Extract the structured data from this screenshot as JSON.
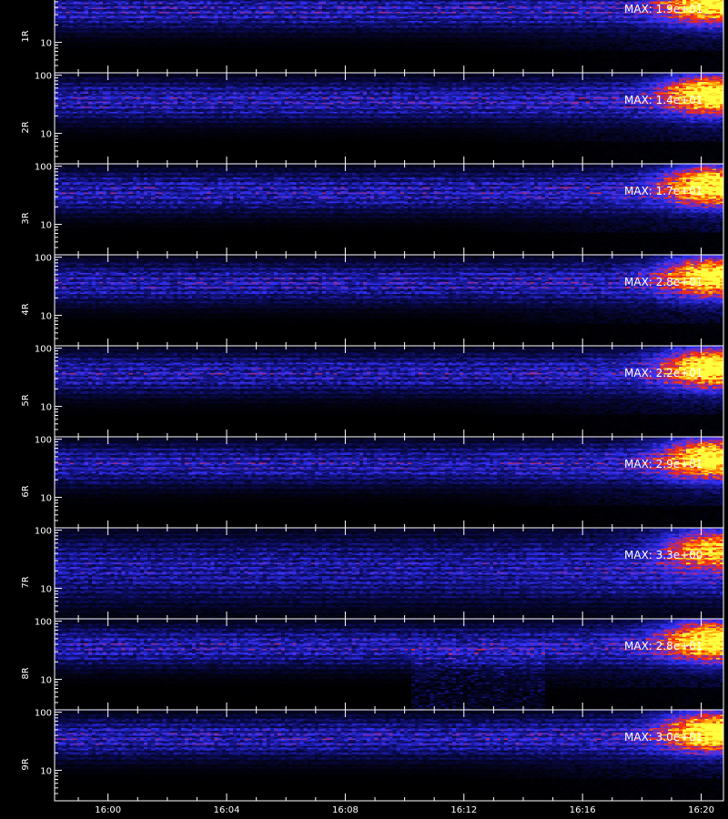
{
  "chart_data": {
    "type": "heatmap",
    "x_ticks": [
      "16:00",
      "16:04",
      "16:08",
      "16:12",
      "16:16",
      "16:20"
    ],
    "x_range": [
      "15:58:12",
      "16:20:45"
    ],
    "y_scale": "log",
    "y_ticks": [
      100,
      10
    ],
    "y_range": [
      3,
      110
    ],
    "colormap": [
      "#000000",
      "#0a0a50",
      "#1c1ca8",
      "#3232ff",
      "#a02a8a",
      "#ff2a00",
      "#ffa000",
      "#ffff40"
    ],
    "panels": [
      {
        "label": "1R",
        "max": "MAX: 1.9e+01"
      },
      {
        "label": "2R",
        "max": "MAX: 1.4e+01"
      },
      {
        "label": "3R",
        "max": "MAX: 1.7e+01"
      },
      {
        "label": "4R",
        "max": "MAX: 2.8e+01"
      },
      {
        "label": "5R",
        "max": "MAX: 2.2e+01"
      },
      {
        "label": "6R",
        "max": "MAX: 2.9e+01"
      },
      {
        "label": "7R",
        "max": "MAX: 3.3e+00"
      },
      {
        "label": "8R",
        "max": "MAX: 2.8e+01"
      },
      {
        "label": "9R",
        "max": "MAX: 3.0e+01"
      }
    ]
  }
}
